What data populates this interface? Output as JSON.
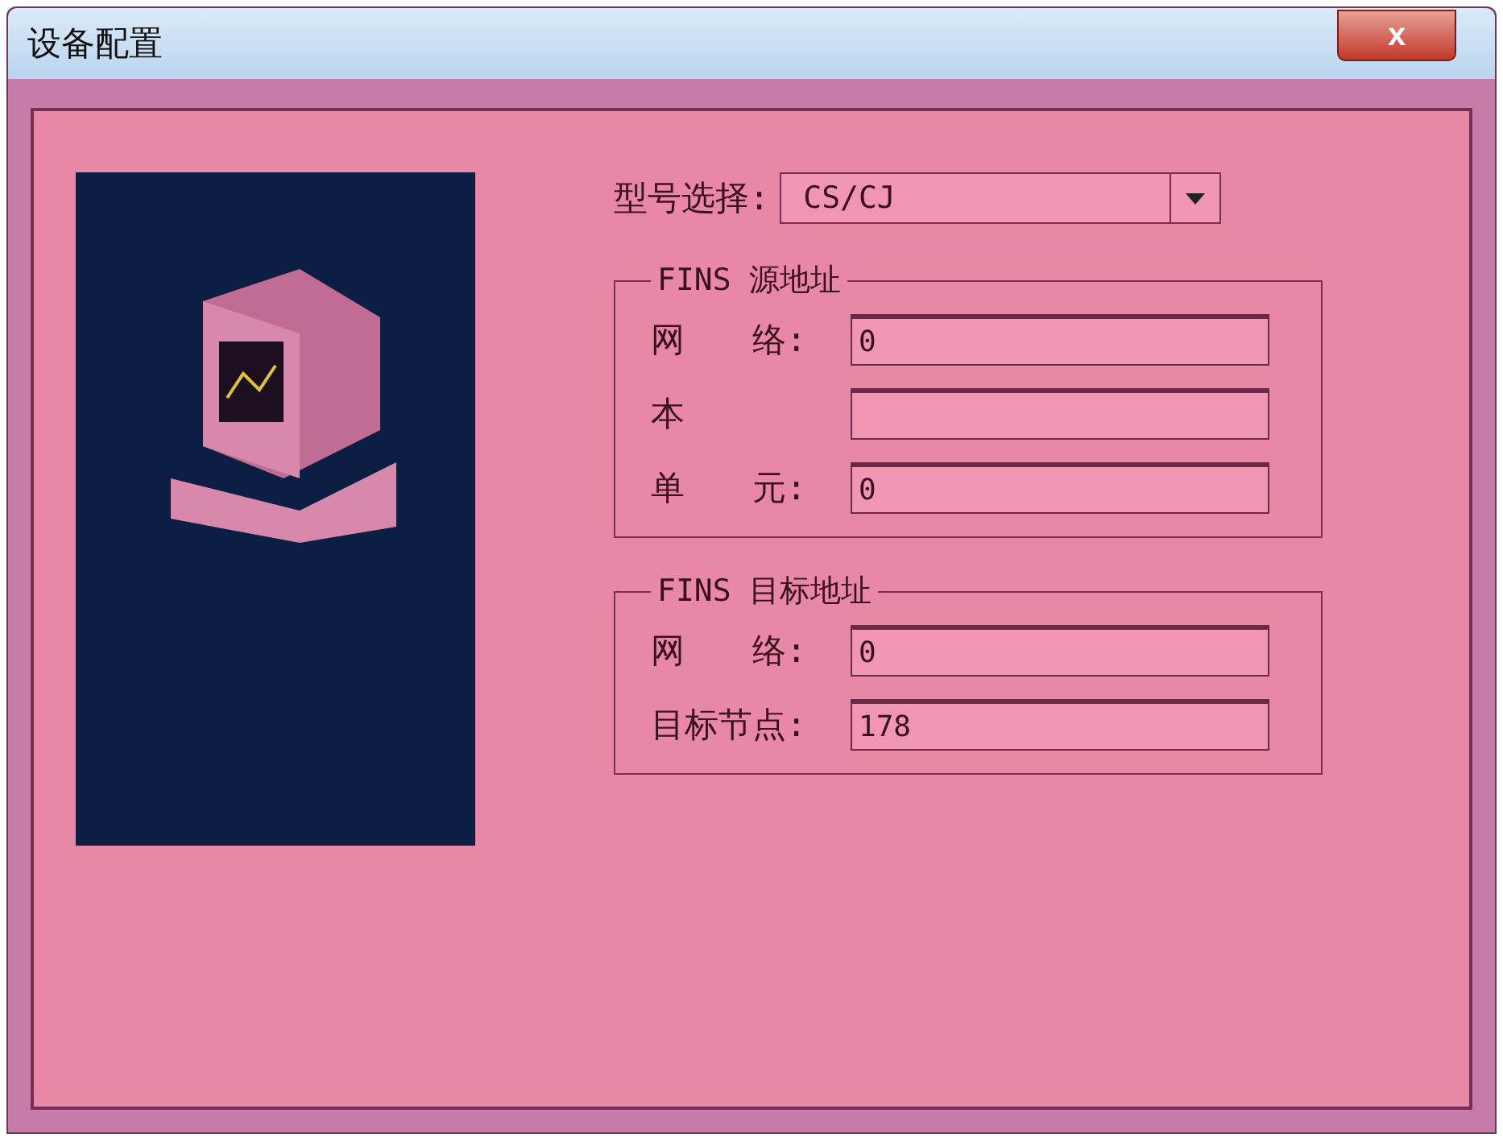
{
  "window": {
    "title": "设备配置",
    "close": "x"
  },
  "model": {
    "label": "型号选择:",
    "value": "CS/CJ"
  },
  "groups": [
    {
      "title": "FINS 源地址",
      "fields": [
        {
          "label": "网　　络:",
          "value": "0"
        },
        {
          "label": "本"
        },
        {
          "label": "单　　元:",
          "value": "0"
        }
      ]
    },
    {
      "title": "FINS 目标地址",
      "fields": [
        {
          "label": "网　　络:",
          "value": "0"
        },
        {
          "label": "目标节点:",
          "value": "178"
        }
      ]
    }
  ]
}
